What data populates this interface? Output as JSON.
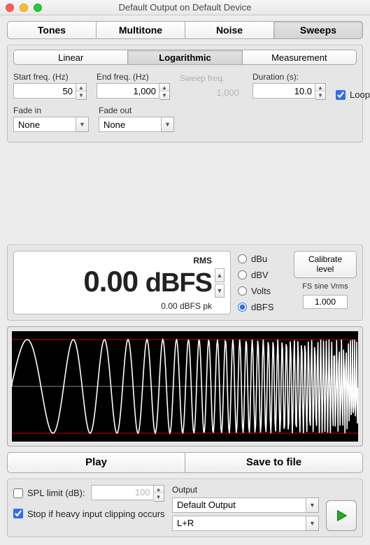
{
  "window": {
    "title": "Default Output on Default Device"
  },
  "tabs_main": {
    "items": [
      "Tones",
      "Multitone",
      "Noise",
      "Sweeps"
    ],
    "active": 3
  },
  "tabs_sweep_type": {
    "items": [
      "Linear",
      "Logarithmic",
      "Measurement"
    ],
    "active": 1
  },
  "params": {
    "start_freq": {
      "label": "Start freq. (Hz)",
      "value": "50"
    },
    "end_freq": {
      "label": "End freq. (Hz)",
      "value": "1,000"
    },
    "sweep_freq": {
      "label": "Sweep freq.",
      "value": "1,000",
      "disabled": true
    },
    "duration": {
      "label": "Duration (s):",
      "value": "10.0"
    },
    "loop": {
      "label": "Loop",
      "checked": true
    },
    "fade_in": {
      "label": "Fade in",
      "value": "None"
    },
    "fade_out": {
      "label": "Fade out",
      "value": "None"
    }
  },
  "level": {
    "rms_label": "RMS",
    "value": "0.00",
    "unit_text": "dBFS",
    "peak_text": "0.00 dBFS pk",
    "units": [
      "dBu",
      "dBV",
      "Volts",
      "dBFS"
    ],
    "unit_selected": "dBFS",
    "calibrate_label": "Calibrate level",
    "fs_vrms_label": "FS sine Vrms",
    "fs_vrms_value": "1.000"
  },
  "actions": {
    "play": "Play",
    "save": "Save to file"
  },
  "bottom": {
    "spl_limit_label": "SPL limit (dB):",
    "spl_limit_value": "100",
    "spl_limit_checked": false,
    "stop_clip_label": "Stop if heavy input clipping occurs",
    "stop_clip_checked": true,
    "output_label": "Output",
    "output_device": "Default Output",
    "output_channels": "L+R"
  },
  "chart_data": {
    "type": "line",
    "title": "",
    "xlabel": "",
    "ylabel": "",
    "description": "Logarithmic frequency sweep preview, full-scale sine, amplitude ±1, frequency increasing left→right",
    "amplitude": 1.0,
    "cycles_visible_approx": 30
  }
}
